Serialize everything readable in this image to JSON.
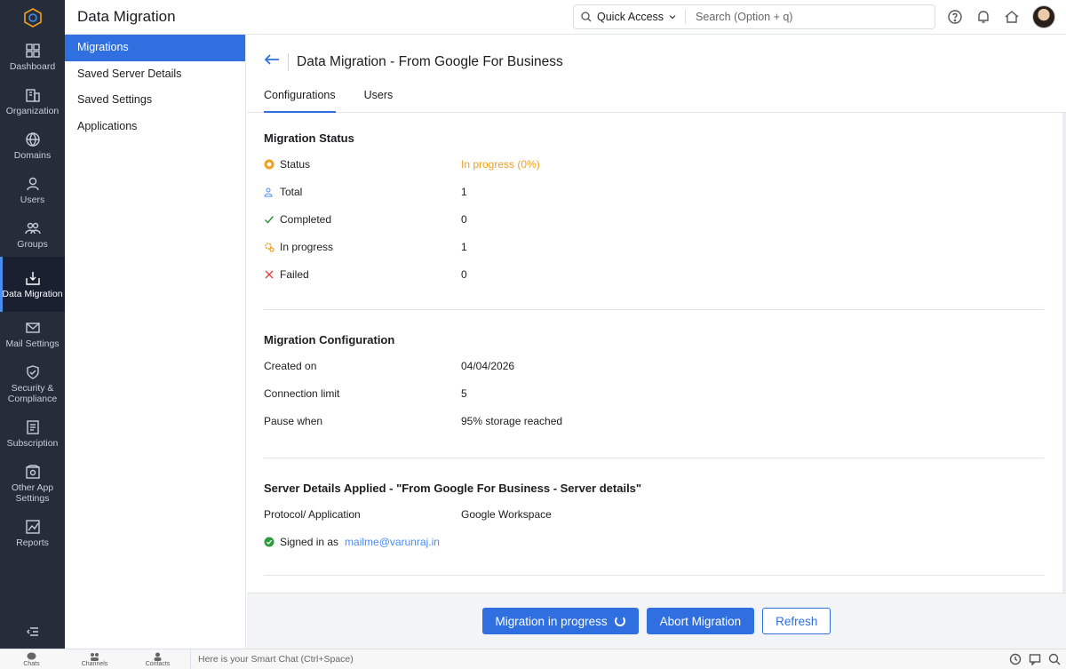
{
  "app": {
    "title": "Data Migration"
  },
  "search": {
    "quick_access": "Quick Access",
    "placeholder": "Search (Option + q)"
  },
  "rail": {
    "items": [
      {
        "label": "Dashboard",
        "icon": "dashboard-icon"
      },
      {
        "label": "Organization",
        "icon": "organization-icon"
      },
      {
        "label": "Domains",
        "icon": "globe-icon"
      },
      {
        "label": "Users",
        "icon": "user-icon"
      },
      {
        "label": "Groups",
        "icon": "groups-icon"
      },
      {
        "label": "Data Migration",
        "icon": "migration-icon",
        "active": true
      },
      {
        "label": "Mail Settings",
        "icon": "mail-settings-icon"
      },
      {
        "label": "Security & Compliance",
        "icon": "shield-icon"
      },
      {
        "label": "Subscription",
        "icon": "subscription-icon"
      },
      {
        "label": "Other App Settings",
        "icon": "apps-icon"
      },
      {
        "label": "Reports",
        "icon": "reports-icon"
      }
    ]
  },
  "subnav": {
    "items": [
      {
        "label": "Migrations"
      },
      {
        "label": "Saved Server Details"
      },
      {
        "label": "Saved Settings"
      },
      {
        "label": "Applications"
      }
    ]
  },
  "page": {
    "title": "Data Migration - From Google For Business",
    "tabs": [
      {
        "label": "Configurations"
      },
      {
        "label": "Users"
      }
    ]
  },
  "status": {
    "heading": "Migration Status",
    "rows": [
      {
        "label": "Status",
        "value": "In progress (0%)"
      },
      {
        "label": "Total",
        "value": "1"
      },
      {
        "label": "Completed",
        "value": "0"
      },
      {
        "label": "In progress",
        "value": "1"
      },
      {
        "label": "Failed",
        "value": "0"
      }
    ]
  },
  "config": {
    "heading": "Migration Configuration",
    "rows": [
      {
        "label": "Created on",
        "value": "04/04/2026"
      },
      {
        "label": "Connection limit",
        "value": "5"
      },
      {
        "label": "Pause when",
        "value": "95% storage reached"
      }
    ]
  },
  "server": {
    "heading": "Server Details Applied - \"From Google For Business - Server details\"",
    "protocol_label": "Protocol/ Application",
    "protocol_value": "Google Workspace",
    "signed_label": "Signed in as",
    "signed_value": "mailme@varunraj.in"
  },
  "actions": {
    "progress_label": "Migration in progress",
    "abort_label": "Abort Migration",
    "refresh_label": "Refresh"
  },
  "chatbar": {
    "tabs": [
      {
        "label": "Chats"
      },
      {
        "label": "Channels"
      },
      {
        "label": "Contacts"
      }
    ],
    "smart_chat_placeholder": "Here is your Smart Chat (Ctrl+Space)"
  },
  "colors": {
    "accent": "#2f6fe0",
    "in_progress": "#f0a01e",
    "success": "#2e9a3e",
    "failed": "#e0413a",
    "rail": "#262d3a"
  }
}
